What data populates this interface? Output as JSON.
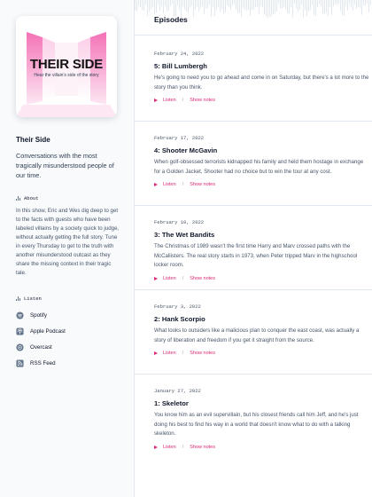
{
  "cover": {
    "title": "THEIR SIDE",
    "subtitle": "Hear the villain's side of the story"
  },
  "podcast": {
    "title": "Their Side",
    "description": "Conversations with the most tragically misunderstood people of our time."
  },
  "about": {
    "heading": "About",
    "text": "In this show, Eric and Wes dig deep to get to the facts with guests who have been labeled villains by a society quick to judge, without actually getting the full story. Tune in every Thursday to get to the truth with another misunderstood outcast as they share the missing context in their tragic tale."
  },
  "listen": {
    "heading": "Listen",
    "items": [
      {
        "label": "Spotify",
        "icon": "spotify-icon"
      },
      {
        "label": "Apple Podcast",
        "icon": "apple-podcast-icon"
      },
      {
        "label": "Overcast",
        "icon": "overcast-icon"
      },
      {
        "label": "RSS Feed",
        "icon": "rss-icon"
      }
    ]
  },
  "main": {
    "title": "Episodes"
  },
  "episodes": [
    {
      "date": "February 24, 2022",
      "title": "5: Bill Lumbergh",
      "description": "He's going to need you to go ahead and come in on Saturday, but there's a lot more to the story than you think.",
      "listen_label": "Listen",
      "notes_label": "Show notes"
    },
    {
      "date": "February 17, 2022",
      "title": "4: Shooter McGavin",
      "description": "When golf-obsessed terrorists kidnapped his family and held them hostage in exchange for a Golden Jacket, Shooter had no choice but to win the tour at any cost.",
      "listen_label": "Listen",
      "notes_label": "Show notes"
    },
    {
      "date": "February 10, 2022",
      "title": "3: The Wet Bandits",
      "description": "The Christmas of 1989 wasn't the first time Harry and Marv crossed paths with the McCallisters. The real story starts in 1973, when Peter tripped Marv in the highschool locker room.",
      "listen_label": "Listen",
      "notes_label": "Show notes"
    },
    {
      "date": "February 3, 2022",
      "title": "2: Hank Scorpio",
      "description": "What looks to outsiders like a malicious plan to conquer the east coast, was actually a story of liberation and freedom if you get it straight from the source.",
      "listen_label": "Listen",
      "notes_label": "Show notes"
    },
    {
      "date": "January 27, 2022",
      "title": "1: Skeletor",
      "description": "You know him as an evil supervillain, but his closest friends call him Jeff, and he's just doing his best to find his way in a world that doesn't know what to do with a talking skeleton.",
      "listen_label": "Listen",
      "notes_label": "Show notes"
    }
  ],
  "colors": {
    "accent": "#db2777",
    "sidebar_bg": "#f8fafc",
    "cover_pink": "#f9a8d4"
  }
}
